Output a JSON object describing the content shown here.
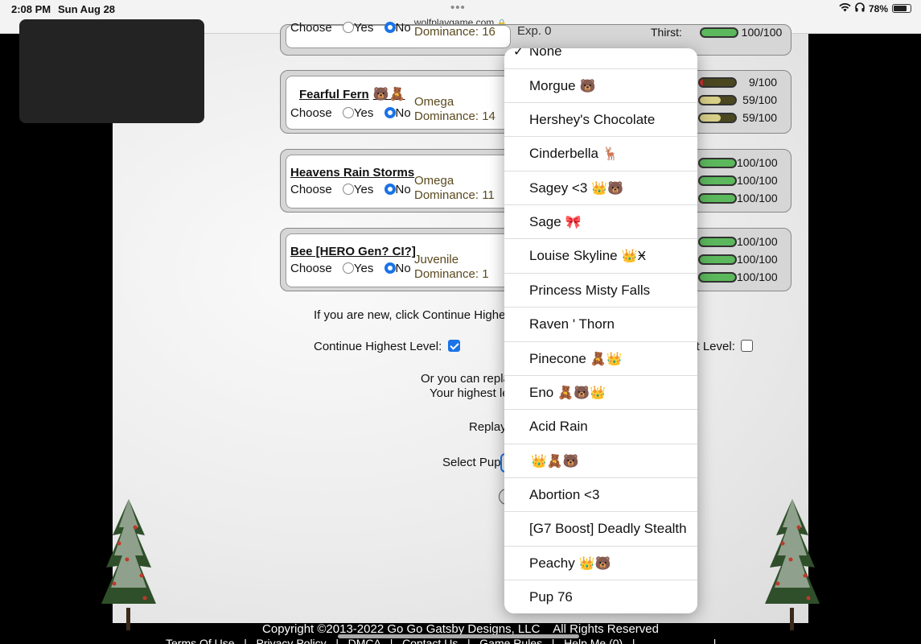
{
  "status_bar": {
    "time": "2:08 PM",
    "date": "Sun Aug 28",
    "url": "wolfplaygame.com",
    "battery": "78%"
  },
  "cards": [
    {
      "name": "",
      "choose_label": "Choose",
      "yes_label": "Yes",
      "no_label": "No",
      "selected": "No",
      "role": "",
      "dominance": "Dominance: 16",
      "extra": "Exp. 0"
    },
    {
      "name": "Fearful Fern",
      "emoji": "🐻🧸",
      "choose_label": "Choose",
      "yes_label": "Yes",
      "no_label": "No",
      "selected": "No",
      "role": "Omega",
      "dominance": "Dominance: 14"
    },
    {
      "name": "Heavens Rain Storms",
      "emoji": "",
      "choose_label": "Choose",
      "yes_label": "Yes",
      "no_label": "No",
      "selected": "No",
      "role": "Omega",
      "dominance": "Dominance: 11"
    },
    {
      "name": "Bee [HERO Gen? CI?]",
      "emoji": "",
      "choose_label": "Choose",
      "yes_label": "Yes",
      "no_label": "No",
      "selected": "No",
      "role": "Juvenile",
      "dominance": "Dominance: 1"
    }
  ],
  "stats": {
    "card0": [
      {
        "label": "Thirst:",
        "value": "100/100",
        "fill": 1.0,
        "color": "green"
      }
    ],
    "card1": [
      {
        "value": "9/100",
        "fill": 0.09,
        "color": "red"
      },
      {
        "value": "59/100",
        "fill": 0.59,
        "color": "tan"
      },
      {
        "value": "59/100",
        "fill": 0.59,
        "color": "tan"
      }
    ],
    "card2": [
      {
        "value": "100/100",
        "fill": 1.0,
        "color": "green"
      },
      {
        "value": "100/100",
        "fill": 1.0,
        "color": "green"
      },
      {
        "value": "100/100",
        "fill": 1.0,
        "color": "green"
      }
    ],
    "card3": [
      {
        "value": "100/100",
        "fill": 1.0,
        "color": "green"
      },
      {
        "value": "100/100",
        "fill": 1.0,
        "color": "green"
      },
      {
        "value": "100/100",
        "fill": 1.0,
        "color": "green"
      }
    ]
  },
  "page_text": {
    "new_hint": "If you are new, click Continue Highest",
    "continue_label": "Continue Highest Level:",
    "other_level_label": "st Level:",
    "replay_line1": "Or you can repla",
    "replay_line2": "Your highest le",
    "replay": "Replay",
    "select_pup": "Select Pup"
  },
  "footer": {
    "copyright": "Copyright ©2013-2022 Go Go Gatsby Designs, LLC    All Rights Reserved",
    "links": "Terms Of Use   |   Privacy Policy   |   DMCA   |   Contact Us   |   Game Rules   |   Help Me (0)   |                         |"
  },
  "dropdown": {
    "selected": "None",
    "options": [
      {
        "label": "None",
        "emoji": ""
      },
      {
        "label": "Morgue",
        "emoji": "🐻"
      },
      {
        "label": "Hershey's Chocolate",
        "emoji": ""
      },
      {
        "label": "Cinderbella",
        "emoji": "🦌"
      },
      {
        "label": "Sagey <3",
        "emoji": "👑🐻"
      },
      {
        "label": "Sage",
        "emoji": "🎀"
      },
      {
        "label": "Louise Skyline",
        "emoji": "👑Ӿ"
      },
      {
        "label": "Princess Misty Falls",
        "emoji": ""
      },
      {
        "label": "Raven ' Thorn",
        "emoji": ""
      },
      {
        "label": "Pinecone",
        "emoji": "🧸👑"
      },
      {
        "label": "Eno",
        "emoji": "🧸🐻👑"
      },
      {
        "label": "Acid Rain",
        "emoji": ""
      },
      {
        "label": "",
        "emoji": "👑🧸🐻"
      },
      {
        "label": "Abortion <3",
        "emoji": ""
      },
      {
        "label": "[G7 Boost] Deadly Stealth",
        "emoji": ""
      },
      {
        "label": "Peachy",
        "emoji": "👑🐻"
      },
      {
        "label": "Pup 76",
        "emoji": ""
      }
    ]
  }
}
